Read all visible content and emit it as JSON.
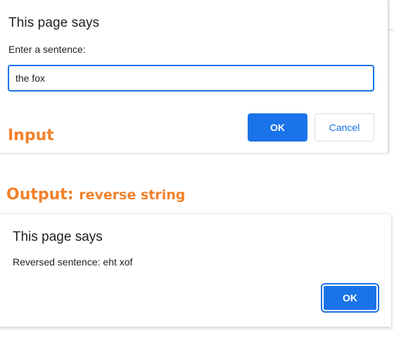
{
  "prompt_dialog": {
    "title": "This page says",
    "label": "Enter a sentence:",
    "input_value": "the fox",
    "ok_label": "OK",
    "cancel_label": "Cancel"
  },
  "annotations": {
    "input_label": "Input",
    "output_label": "Output:",
    "output_sublabel": "reverse string"
  },
  "alert_dialog": {
    "title": "This page says",
    "message": "Reversed sentence: eht xof",
    "ok_label": "OK"
  },
  "colors": {
    "accent": "#1a73e8",
    "annotation": "#f2812b"
  }
}
